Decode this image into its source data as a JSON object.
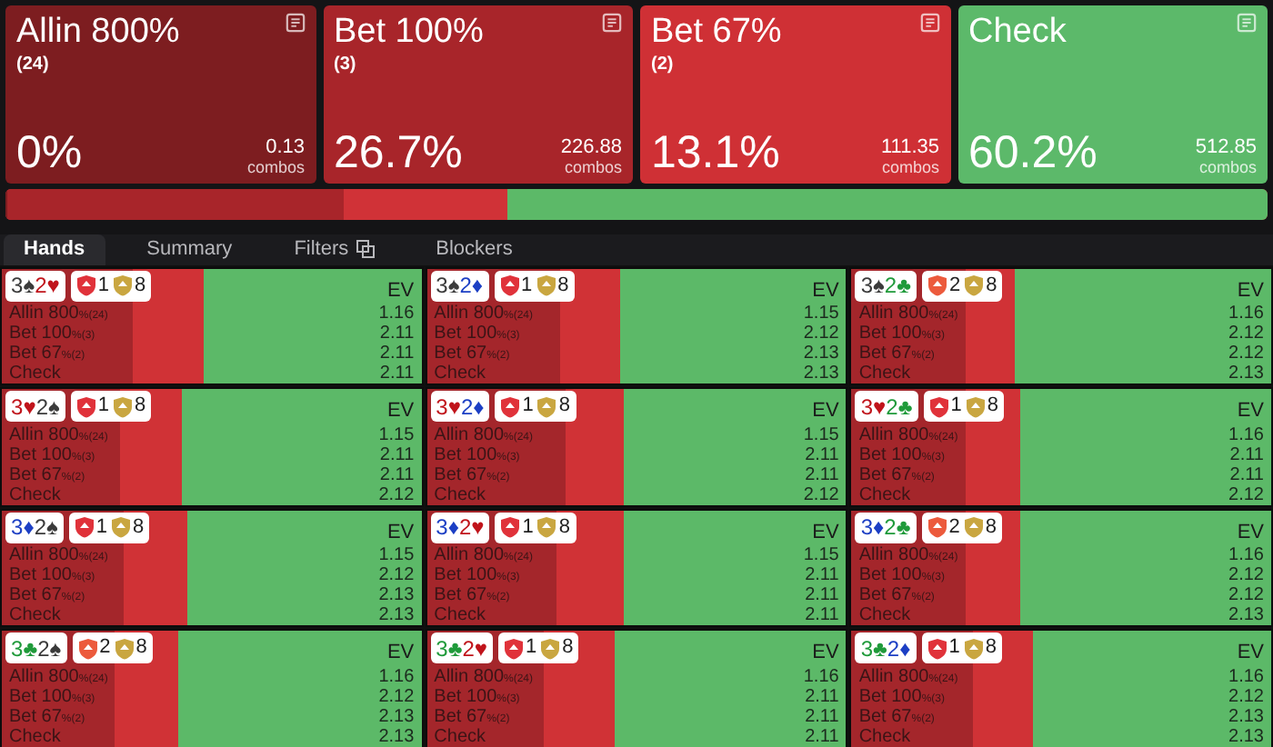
{
  "actions": [
    {
      "kind": "allin",
      "title": "Allin 800%",
      "count": "(24)",
      "percent": "0%",
      "combos": "0.13",
      "combos_label": "combos"
    },
    {
      "kind": "bet100",
      "title": "Bet 100%",
      "count": "(3)",
      "percent": "26.7%",
      "combos": "226.88",
      "combos_label": "combos"
    },
    {
      "kind": "bet67",
      "title": "Bet 67%",
      "count": "(2)",
      "percent": "13.1%",
      "combos": "111.35",
      "combos_label": "combos"
    },
    {
      "kind": "check",
      "title": "Check",
      "percent": "60.2%",
      "combos": "512.85",
      "combos_label": "combos"
    }
  ],
  "frequency_bar": [
    {
      "kind": "allin",
      "level": 0.001
    },
    {
      "kind": "bet100",
      "level": 0.267
    },
    {
      "kind": "bet67"
    },
    {
      "kind": "check",
      "level": 0.602
    }
  ],
  "tabs": [
    {
      "label": "Hands",
      "selected": true
    },
    {
      "label": "Summary",
      "selected": false
    },
    {
      "label": "Filters",
      "selected": false,
      "icon": true
    },
    {
      "label": "Blockers",
      "selected": false
    }
  ],
  "hands": [
    {
      "cards": [
        {
          "rank": "3",
          "suit": "♠",
          "color": "#3a3a3a"
        },
        {
          "rank": "2",
          "suit": "♥",
          "color": "#c0141b"
        }
      ],
      "badges": [
        {
          "count": "1",
          "color": "#e0323a"
        },
        {
          "count": "8",
          "color": "#c9a640"
        }
      ],
      "ev_label": "EV",
      "rows": [
        {
          "name": "Allin 800",
          "note": "%(24)",
          "ev": "1.16"
        },
        {
          "name": "Bet 100",
          "note": "%(3)",
          "ev": "2.11",
          "level": 0.31
        },
        {
          "name": "Bet 67",
          "note": "%(2)",
          "ev": "2.11"
        },
        {
          "name": "Check",
          "ev": "2.11",
          "level": 0.52
        }
      ]
    },
    {
      "cards": [
        {
          "rank": "3",
          "suit": "♠",
          "color": "#3a3a3a"
        },
        {
          "rank": "2",
          "suit": "♦",
          "color": "#1c3fc4"
        }
      ],
      "badges": [
        {
          "count": "1",
          "color": "#e0323a"
        },
        {
          "count": "8",
          "color": "#c9a640"
        }
      ],
      "ev_label": "EV",
      "rows": [
        {
          "name": "Allin 800",
          "note": "%(24)",
          "ev": "1.15"
        },
        {
          "name": "Bet 100",
          "note": "%(3)",
          "ev": "2.12",
          "level": 0.32
        },
        {
          "name": "Bet 67",
          "note": "%(2)",
          "ev": "2.13"
        },
        {
          "name": "Check",
          "ev": "2.13",
          "level": 0.54
        }
      ]
    },
    {
      "cards": [
        {
          "rank": "3",
          "suit": "♠",
          "color": "#3a3a3a"
        },
        {
          "rank": "2",
          "suit": "♣",
          "color": "#1f9a3a"
        }
      ],
      "badges": [
        {
          "count": "2",
          "color": "#ec5a3c"
        },
        {
          "count": "8",
          "color": "#c9a640"
        }
      ],
      "ev_label": "EV",
      "rows": [
        {
          "name": "Allin 800",
          "note": "%(24)",
          "ev": "1.16"
        },
        {
          "name": "Bet 100",
          "note": "%(3)",
          "ev": "2.12",
          "level": 0.27
        },
        {
          "name": "Bet 67",
          "note": "%(2)",
          "ev": "2.12"
        },
        {
          "name": "Check",
          "ev": "2.13",
          "level": 0.61
        }
      ]
    },
    {
      "cards": [
        {
          "rank": "3",
          "suit": "♥",
          "color": "#c0141b"
        },
        {
          "rank": "2",
          "suit": "♠",
          "color": "#3a3a3a"
        }
      ],
      "badges": [
        {
          "count": "1",
          "color": "#e0323a"
        },
        {
          "count": "8",
          "color": "#c9a640"
        }
      ],
      "ev_label": "EV",
      "rows": [
        {
          "name": "Allin 800",
          "note": "%(24)",
          "ev": "1.15"
        },
        {
          "name": "Bet 100",
          "note": "%(3)",
          "ev": "2.11",
          "level": 0.28
        },
        {
          "name": "Bet 67",
          "note": "%(2)",
          "ev": "2.11"
        },
        {
          "name": "Check",
          "ev": "2.12",
          "level": 0.57
        }
      ]
    },
    {
      "cards": [
        {
          "rank": "3",
          "suit": "♥",
          "color": "#c0141b"
        },
        {
          "rank": "2",
          "suit": "♦",
          "color": "#1c3fc4"
        }
      ],
      "badges": [
        {
          "count": "1",
          "color": "#e0323a"
        },
        {
          "count": "8",
          "color": "#c9a640"
        }
      ],
      "ev_label": "EV",
      "rows": [
        {
          "name": "Allin 800",
          "note": "%(24)",
          "ev": "1.15"
        },
        {
          "name": "Bet 100",
          "note": "%(3)",
          "ev": "2.11",
          "level": 0.33
        },
        {
          "name": "Bet 67",
          "note": "%(2)",
          "ev": "2.11"
        },
        {
          "name": "Check",
          "ev": "2.12",
          "level": 0.53
        }
      ]
    },
    {
      "cards": [
        {
          "rank": "3",
          "suit": "♥",
          "color": "#c0141b"
        },
        {
          "rank": "2",
          "suit": "♣",
          "color": "#1f9a3a"
        }
      ],
      "badges": [
        {
          "count": "1",
          "color": "#e0323a"
        },
        {
          "count": "8",
          "color": "#c9a640"
        }
      ],
      "ev_label": "EV",
      "rows": [
        {
          "name": "Allin 800",
          "note": "%(24)",
          "ev": "1.16"
        },
        {
          "name": "Bet 100",
          "note": "%(3)",
          "ev": "2.11",
          "level": 0.27
        },
        {
          "name": "Bet 67",
          "note": "%(2)",
          "ev": "2.11"
        },
        {
          "name": "Check",
          "ev": "2.12",
          "level": 0.6
        }
      ]
    },
    {
      "cards": [
        {
          "rank": "3",
          "suit": "♦",
          "color": "#1c3fc4"
        },
        {
          "rank": "2",
          "suit": "♠",
          "color": "#3a3a3a"
        }
      ],
      "badges": [
        {
          "count": "1",
          "color": "#e0323a"
        },
        {
          "count": "8",
          "color": "#c9a640"
        }
      ],
      "ev_label": "EV",
      "rows": [
        {
          "name": "Allin 800",
          "note": "%(24)",
          "ev": "1.15"
        },
        {
          "name": "Bet 100",
          "note": "%(3)",
          "ev": "2.12",
          "level": 0.29
        },
        {
          "name": "Bet 67",
          "note": "%(2)",
          "ev": "2.13"
        },
        {
          "name": "Check",
          "ev": "2.13",
          "level": 0.56
        }
      ]
    },
    {
      "cards": [
        {
          "rank": "3",
          "suit": "♦",
          "color": "#1c3fc4"
        },
        {
          "rank": "2",
          "suit": "♥",
          "color": "#c0141b"
        }
      ],
      "badges": [
        {
          "count": "1",
          "color": "#e0323a"
        },
        {
          "count": "8",
          "color": "#c9a640"
        }
      ],
      "ev_label": "EV",
      "rows": [
        {
          "name": "Allin 800",
          "note": "%(24)",
          "ev": "1.15"
        },
        {
          "name": "Bet 100",
          "note": "%(3)",
          "ev": "2.11",
          "level": 0.31
        },
        {
          "name": "Bet 67",
          "note": "%(2)",
          "ev": "2.11"
        },
        {
          "name": "Check",
          "ev": "2.11",
          "level": 0.53
        }
      ]
    },
    {
      "cards": [
        {
          "rank": "3",
          "suit": "♦",
          "color": "#1c3fc4"
        },
        {
          "rank": "2",
          "suit": "♣",
          "color": "#1f9a3a"
        }
      ],
      "badges": [
        {
          "count": "2",
          "color": "#ec5a3c"
        },
        {
          "count": "8",
          "color": "#c9a640"
        }
      ],
      "ev_label": "EV",
      "rows": [
        {
          "name": "Allin 800",
          "note": "%(24)",
          "ev": "1.16"
        },
        {
          "name": "Bet 100",
          "note": "%(3)",
          "ev": "2.12",
          "level": 0.27
        },
        {
          "name": "Bet 67",
          "note": "%(2)",
          "ev": "2.12"
        },
        {
          "name": "Check",
          "ev": "2.13",
          "level": 0.6
        }
      ]
    },
    {
      "cards": [
        {
          "rank": "3",
          "suit": "♣",
          "color": "#1f9a3a"
        },
        {
          "rank": "2",
          "suit": "♠",
          "color": "#3a3a3a"
        }
      ],
      "badges": [
        {
          "count": "2",
          "color": "#ec5a3c"
        },
        {
          "count": "8",
          "color": "#c9a640"
        }
      ],
      "ev_label": "EV",
      "rows": [
        {
          "name": "Allin 800",
          "note": "%(24)",
          "ev": "1.16"
        },
        {
          "name": "Bet 100",
          "note": "%(3)",
          "ev": "2.12",
          "level": 0.27
        },
        {
          "name": "Bet 67",
          "note": "%(2)",
          "ev": "2.13"
        },
        {
          "name": "Check",
          "ev": "2.13",
          "level": 0.58
        }
      ]
    },
    {
      "cards": [
        {
          "rank": "3",
          "suit": "♣",
          "color": "#1f9a3a"
        },
        {
          "rank": "2",
          "suit": "♥",
          "color": "#c0141b"
        }
      ],
      "badges": [
        {
          "count": "1",
          "color": "#e0323a"
        },
        {
          "count": "8",
          "color": "#c9a640"
        }
      ],
      "ev_label": "EV",
      "rows": [
        {
          "name": "Allin 800",
          "note": "%(24)",
          "ev": "1.16"
        },
        {
          "name": "Bet 100",
          "note": "%(3)",
          "ev": "2.11",
          "level": 0.28
        },
        {
          "name": "Bet 67",
          "note": "%(2)",
          "ev": "2.11"
        },
        {
          "name": "Check",
          "ev": "2.11",
          "level": 0.55
        }
      ]
    },
    {
      "cards": [
        {
          "rank": "3",
          "suit": "♣",
          "color": "#1f9a3a"
        },
        {
          "rank": "2",
          "suit": "♦",
          "color": "#1c3fc4"
        }
      ],
      "badges": [
        {
          "count": "1",
          "color": "#e0323a"
        },
        {
          "count": "8",
          "color": "#c9a640"
        }
      ],
      "ev_label": "EV",
      "rows": [
        {
          "name": "Allin 800",
          "note": "%(24)",
          "ev": "1.16"
        },
        {
          "name": "Bet 100",
          "note": "%(3)",
          "ev": "2.12",
          "level": 0.29
        },
        {
          "name": "Bet 67",
          "note": "%(2)",
          "ev": "2.13"
        },
        {
          "name": "Check",
          "ev": "2.13",
          "level": 0.57
        }
      ]
    }
  ]
}
